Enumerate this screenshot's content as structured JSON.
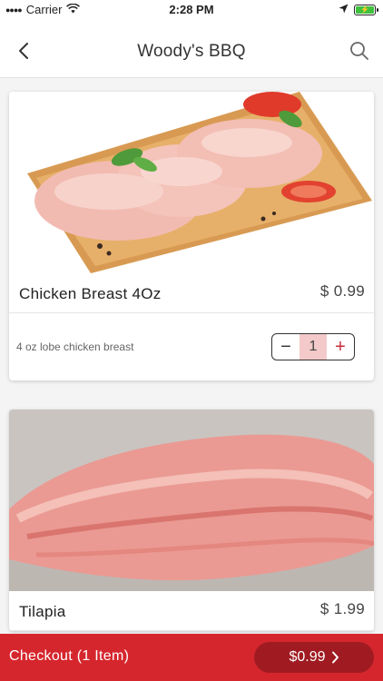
{
  "status_bar": {
    "carrier": "Carrier",
    "time": "2:28 PM"
  },
  "nav": {
    "title": "Woody's BBQ",
    "back_icon": "chevron-left-icon",
    "search_icon": "search-icon"
  },
  "products": [
    {
      "name": "Chicken Breast 4Oz",
      "price": "$ 0.99",
      "description": "4 oz lobe chicken breast",
      "quantity": "1",
      "image": "raw-chicken-breasts-on-board"
    },
    {
      "name": "Tilapia",
      "price": "$ 1.99",
      "image": "raw-tilapia-fillet"
    }
  ],
  "checkout": {
    "label": "Checkout (1 Item)",
    "total": "$0.99"
  },
  "colors": {
    "accent": "#d6262d",
    "accent_dark": "#9f1b21",
    "qty_bg": "#f3c9c9"
  }
}
